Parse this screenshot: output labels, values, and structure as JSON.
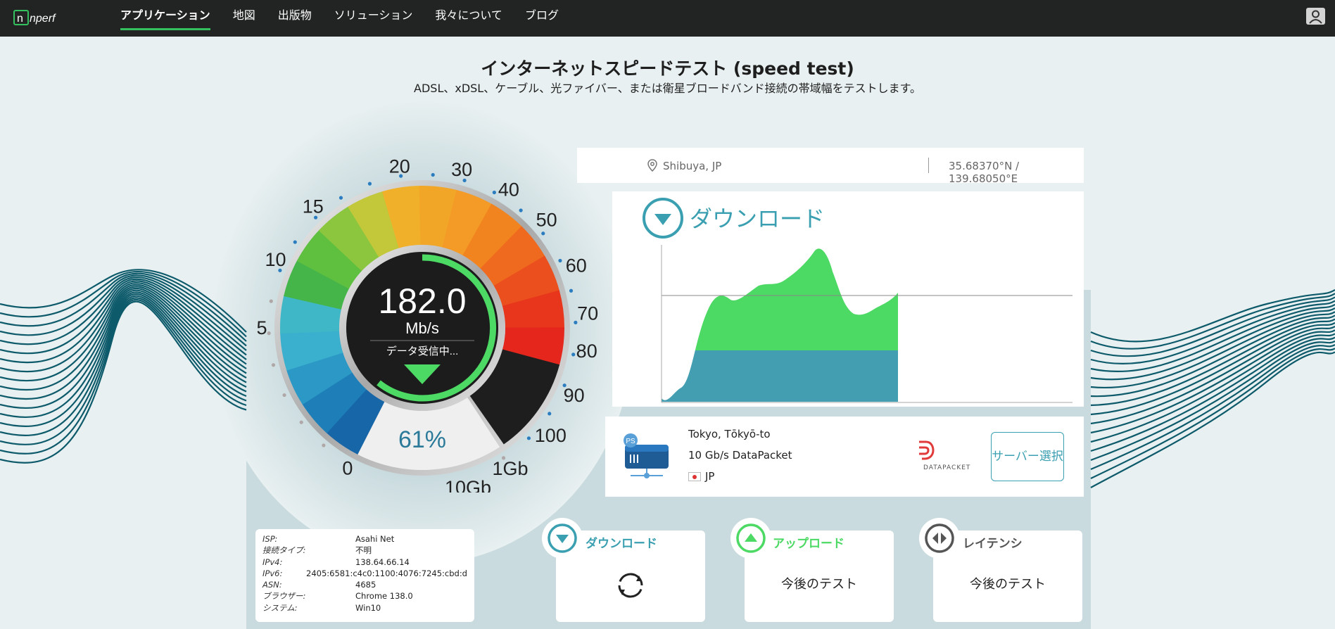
{
  "nav": {
    "logo_text": "nperf",
    "items": [
      "アプリケーション",
      "地図",
      "出版物",
      "ソリューション",
      "我々について",
      "ブログ"
    ],
    "active_index": 0
  },
  "header": {
    "title": "インターネットスピードテスト (speed test)",
    "subtitle": "ADSL、xDSL、ケーブル、光ファイバー、または衛星ブロードバンド接続の帯域幅をテストします。"
  },
  "gauge": {
    "speed": "182.0",
    "unit": "Mb/s",
    "status": "データ受信中...",
    "progress_label": "61%",
    "progress": 0.61,
    "scale_labels": [
      "0",
      "5",
      "10",
      "15",
      "20",
      "30",
      "40",
      "50",
      "60",
      "70",
      "80",
      "90",
      "100",
      "1Gb",
      "10Gb"
    ]
  },
  "location": {
    "city": "Shibuya, JP",
    "coords": "35.68370°N / 139.68050°E"
  },
  "download_panel": {
    "title": "ダウンロード"
  },
  "server": {
    "city": "Tokyo, Tōkyō-to",
    "provider": "10 Gb/s DataPacket",
    "country": "JP",
    "badge": "PS",
    "brand": "DATAPACKET",
    "select_button": "サーバー選択"
  },
  "info": {
    "rows": [
      {
        "key": "ISP:",
        "value": "Asahi Net"
      },
      {
        "key": "接続タイプ:",
        "value": "不明"
      },
      {
        "key": "IPv4:",
        "value": "138.64.66.14"
      },
      {
        "key": "IPv6:",
        "value": "2405:6581:c4c0:1100:4076:7245:cbd:d"
      },
      {
        "key": "ASN:",
        "value": "4685"
      },
      {
        "key": "ブラウザー:",
        "value": "Chrome 138.0"
      },
      {
        "key": "システム:",
        "value": "Win10"
      }
    ]
  },
  "cards": {
    "download": {
      "label": "ダウンロード"
    },
    "upload": {
      "label": "アップロード",
      "value": "今後のテスト"
    },
    "latency": {
      "label": "レイテンシ",
      "value": "今後のテスト"
    }
  },
  "colors": {
    "teal": "#3a9fb0",
    "green": "#4cd964",
    "dark": "#222323"
  }
}
